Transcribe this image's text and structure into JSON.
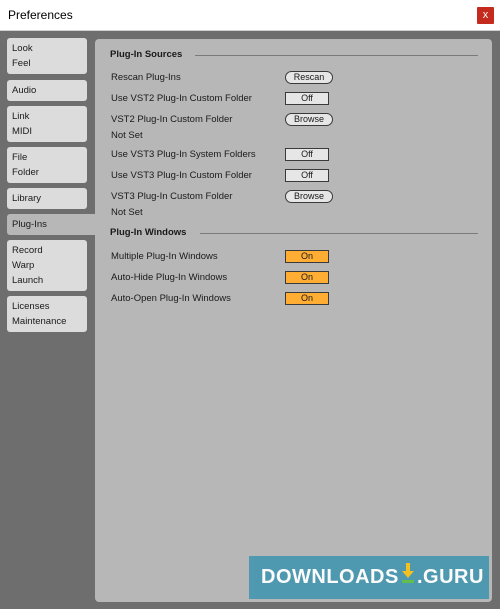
{
  "window": {
    "title": "Preferences",
    "close_glyph": "x"
  },
  "sidebar": {
    "tabs": [
      {
        "line1": "Look",
        "line2": "Feel"
      },
      {
        "line1": "Audio"
      },
      {
        "line1": "Link",
        "line2": "MIDI"
      },
      {
        "line1": "File",
        "line2": "Folder"
      },
      {
        "line1": "Library"
      },
      {
        "line1": "Plug-Ins",
        "active": true
      },
      {
        "line1": "Record",
        "line2": "Warp",
        "line3": "Launch"
      },
      {
        "line1": "Licenses",
        "line2": "Maintenance"
      }
    ]
  },
  "plugin_sources": {
    "title": "Plug-In Sources",
    "rows": [
      {
        "label": "Rescan Plug-Ins",
        "control": "Rescan",
        "kind": "pill"
      },
      {
        "label": "Use VST2 Plug-In Custom Folder",
        "control": "Off",
        "kind": "toggle"
      },
      {
        "label": "VST2 Plug-In Custom Folder",
        "control": "Browse",
        "kind": "pill",
        "sub": "Not Set"
      },
      {
        "label": "Use VST3 Plug-In System Folders",
        "control": "Off",
        "kind": "toggle"
      },
      {
        "label": "Use VST3 Plug-In Custom Folder",
        "control": "Off",
        "kind": "toggle"
      },
      {
        "label": "VST3 Plug-In Custom Folder",
        "control": "Browse",
        "kind": "pill",
        "sub": "Not Set"
      }
    ]
  },
  "plugin_windows": {
    "title": "Plug-In Windows",
    "rows": [
      {
        "label": "Multiple Plug-In Windows",
        "control": "On",
        "kind": "toggle-on"
      },
      {
        "label": "Auto-Hide Plug-In Windows",
        "control": "On",
        "kind": "toggle-on"
      },
      {
        "label": "Auto-Open Plug-In Windows",
        "control": "On",
        "kind": "toggle-on"
      }
    ]
  },
  "watermark": {
    "text_left": "DOWNLOADS",
    "text_right": ".GURU"
  },
  "colors": {
    "on_toggle": "#ffad33",
    "panel": "#b7b7b7",
    "background": "#6e6e6e",
    "close": "#c42b1c"
  }
}
